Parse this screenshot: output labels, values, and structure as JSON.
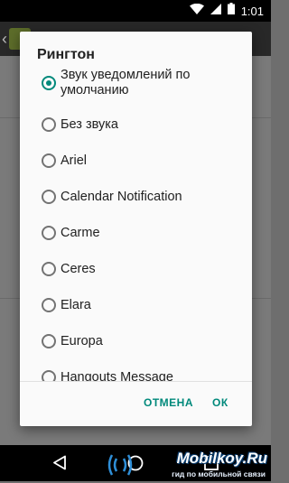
{
  "status_bar": {
    "time": "1:01"
  },
  "dialog": {
    "title": "Рингтон",
    "options": [
      {
        "label": "Звук уведомлений по умолчанию",
        "checked": true
      },
      {
        "label": "Без звука",
        "checked": false
      },
      {
        "label": "Ariel",
        "checked": false
      },
      {
        "label": "Calendar Notification",
        "checked": false
      },
      {
        "label": "Carme",
        "checked": false
      },
      {
        "label": "Ceres",
        "checked": false
      },
      {
        "label": "Elara",
        "checked": false
      },
      {
        "label": "Europa",
        "checked": false
      },
      {
        "label": "Hangouts Message",
        "checked": false
      }
    ],
    "buttons": {
      "cancel": "ОТМЕНА",
      "ok": "ОК"
    }
  },
  "watermark": {
    "title": "Mobilkoy.Ru",
    "subtitle": "гид по мобильной связи"
  },
  "colors": {
    "accent": "#00897b",
    "dialog_bg": "#fafafa",
    "scrim": "#7a7a7a"
  },
  "icons": [
    "wifi-icon",
    "signal-icon",
    "battery-icon",
    "back-icon",
    "home-icon",
    "recents-icon"
  ]
}
